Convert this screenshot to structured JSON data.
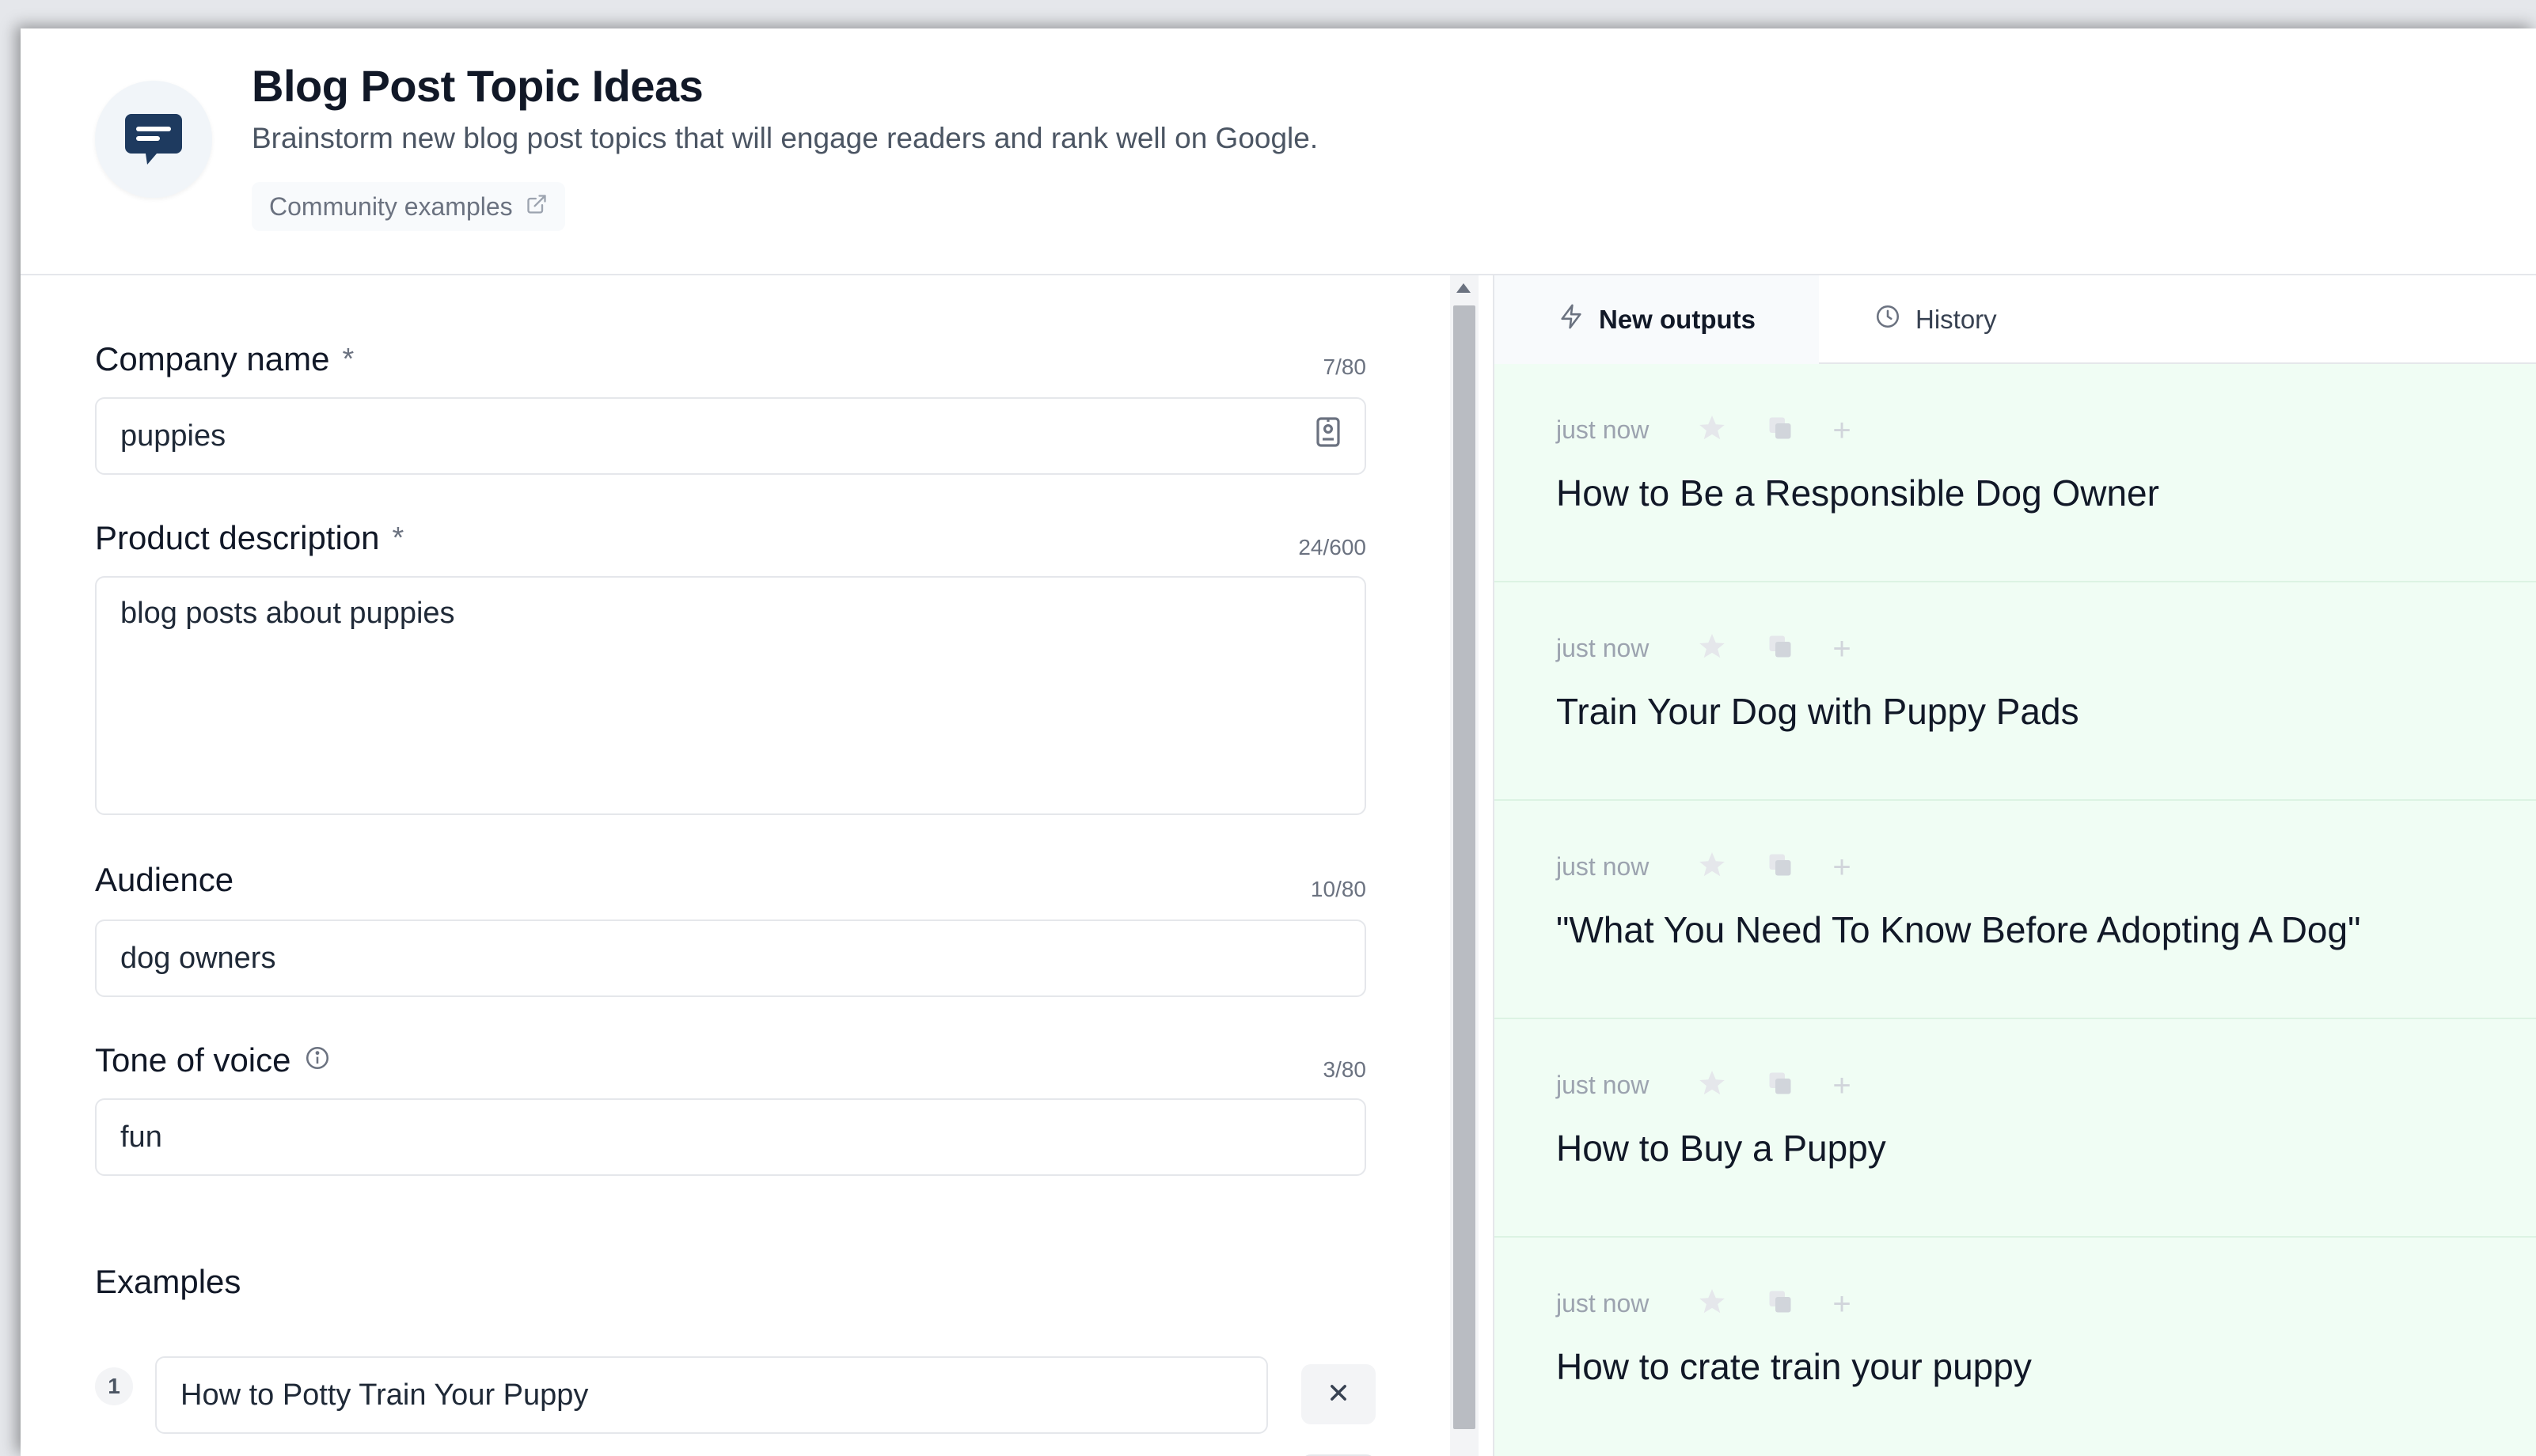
{
  "header": {
    "title": "Blog Post Topic Ideas",
    "subtitle": "Brainstorm new blog post topics that will engage readers and rank well on Google.",
    "community_label": "Community examples",
    "icon": "chat-bubble-icon"
  },
  "form": {
    "company": {
      "label": "Company name",
      "required": "*",
      "counter": "7/80",
      "value": "puppies"
    },
    "product": {
      "label": "Product description",
      "required": "*",
      "counter": "24/600",
      "value": "blog posts about puppies"
    },
    "audience": {
      "label": "Audience",
      "counter": "10/80",
      "value": "dog owners"
    },
    "tone": {
      "label": "Tone of voice",
      "counter": "3/80",
      "value": "fun"
    },
    "examples": {
      "label": "Examples",
      "items": [
        {
          "num": "1",
          "value": "How to Potty Train Your Puppy"
        }
      ]
    }
  },
  "panel": {
    "tabs": [
      {
        "label": "New outputs",
        "icon": "lightning-icon"
      },
      {
        "label": "History",
        "icon": "clock-icon"
      }
    ],
    "outputs": [
      {
        "time": "just now",
        "text": "How to Be a Responsible Dog Owner"
      },
      {
        "time": "just now",
        "text": "Train Your Dog with Puppy Pads"
      },
      {
        "time": "just now",
        "text": "\"What You Need To Know Before Adopting A Dog\""
      },
      {
        "time": "just now",
        "text": "How to Buy a Puppy"
      },
      {
        "time": "just now",
        "text": "How to crate train your puppy"
      }
    ]
  },
  "colors": {
    "icon_navy": "#1e3a5f",
    "panel_bg": "#f0fdf4"
  }
}
